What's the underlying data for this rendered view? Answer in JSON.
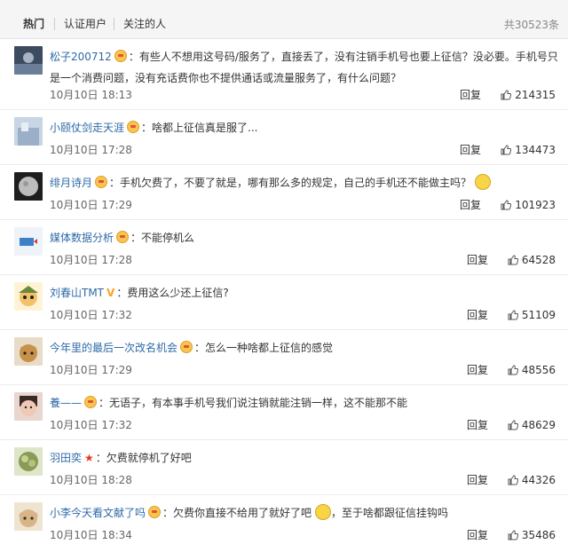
{
  "tabs": [
    {
      "label": "热门"
    },
    {
      "label": "认证用户"
    },
    {
      "label": "关注的人"
    }
  ],
  "total_label": "共30523条",
  "reply_label": "回复",
  "comments": [
    {
      "user": "松子200712",
      "text": "有些人不想用这号码/服务了，直接丢了，没有注销手机号也要上征信？没必要。手机号只",
      "text2": "是一个消费问题，没有充话费你也不提供通话或流量服务了，有什么问题？",
      "time": "10月10日 18:13",
      "likes": "214315",
      "avatar_color": "#3c4b60"
    },
    {
      "user": "小颐仗剑走天涯",
      "text": "啥都上征信真是服了...",
      "time": "10月10日 17:28",
      "likes": "134473",
      "avatar_color": "#9bb0c8"
    },
    {
      "user": "绯月诗月",
      "text": "手机欠费了，不要了就是，哪有那么多的规定，自己的手机还不能做主吗？",
      "time": "10月10日 17:29",
      "likes": "101923",
      "avatar_color": "#2a2a2a"
    },
    {
      "user": "媒体数据分析",
      "text": "不能停机么",
      "time": "10月10日 17:28",
      "likes": "64528",
      "avatar_color": "#d7e4f2"
    },
    {
      "user": "刘春山TMT",
      "text": "费用这么少还上征信?",
      "time": "10月10日 17:32",
      "likes": "51109",
      "avatar_color": "#f0b860"
    },
    {
      "user": "今年里的最后一次改名机会",
      "text": "怎么一种啥都上征信的感觉",
      "time": "10月10日 17:29",
      "likes": "48556",
      "avatar_color": "#b58b52"
    },
    {
      "user": "養——",
      "text": "无语子，有本事手机号我们说注销就能注销一样，这不能那不能",
      "time": "10月10日 17:32",
      "likes": "48629",
      "avatar_color": "#c9a192"
    },
    {
      "user": "羽田奕",
      "text": "欠费就停机了好吧",
      "time": "10月10日 18:28",
      "likes": "44326",
      "avatar_color": "#8a9a58"
    },
    {
      "user": "小李今天看文献了吗",
      "text": "欠费你直接不给用了就好了吧",
      "text_after": "，至于啥都跟征信挂钩吗",
      "time": "10月10日 18:34",
      "likes": "35486",
      "avatar_color": "#c7a478"
    }
  ]
}
